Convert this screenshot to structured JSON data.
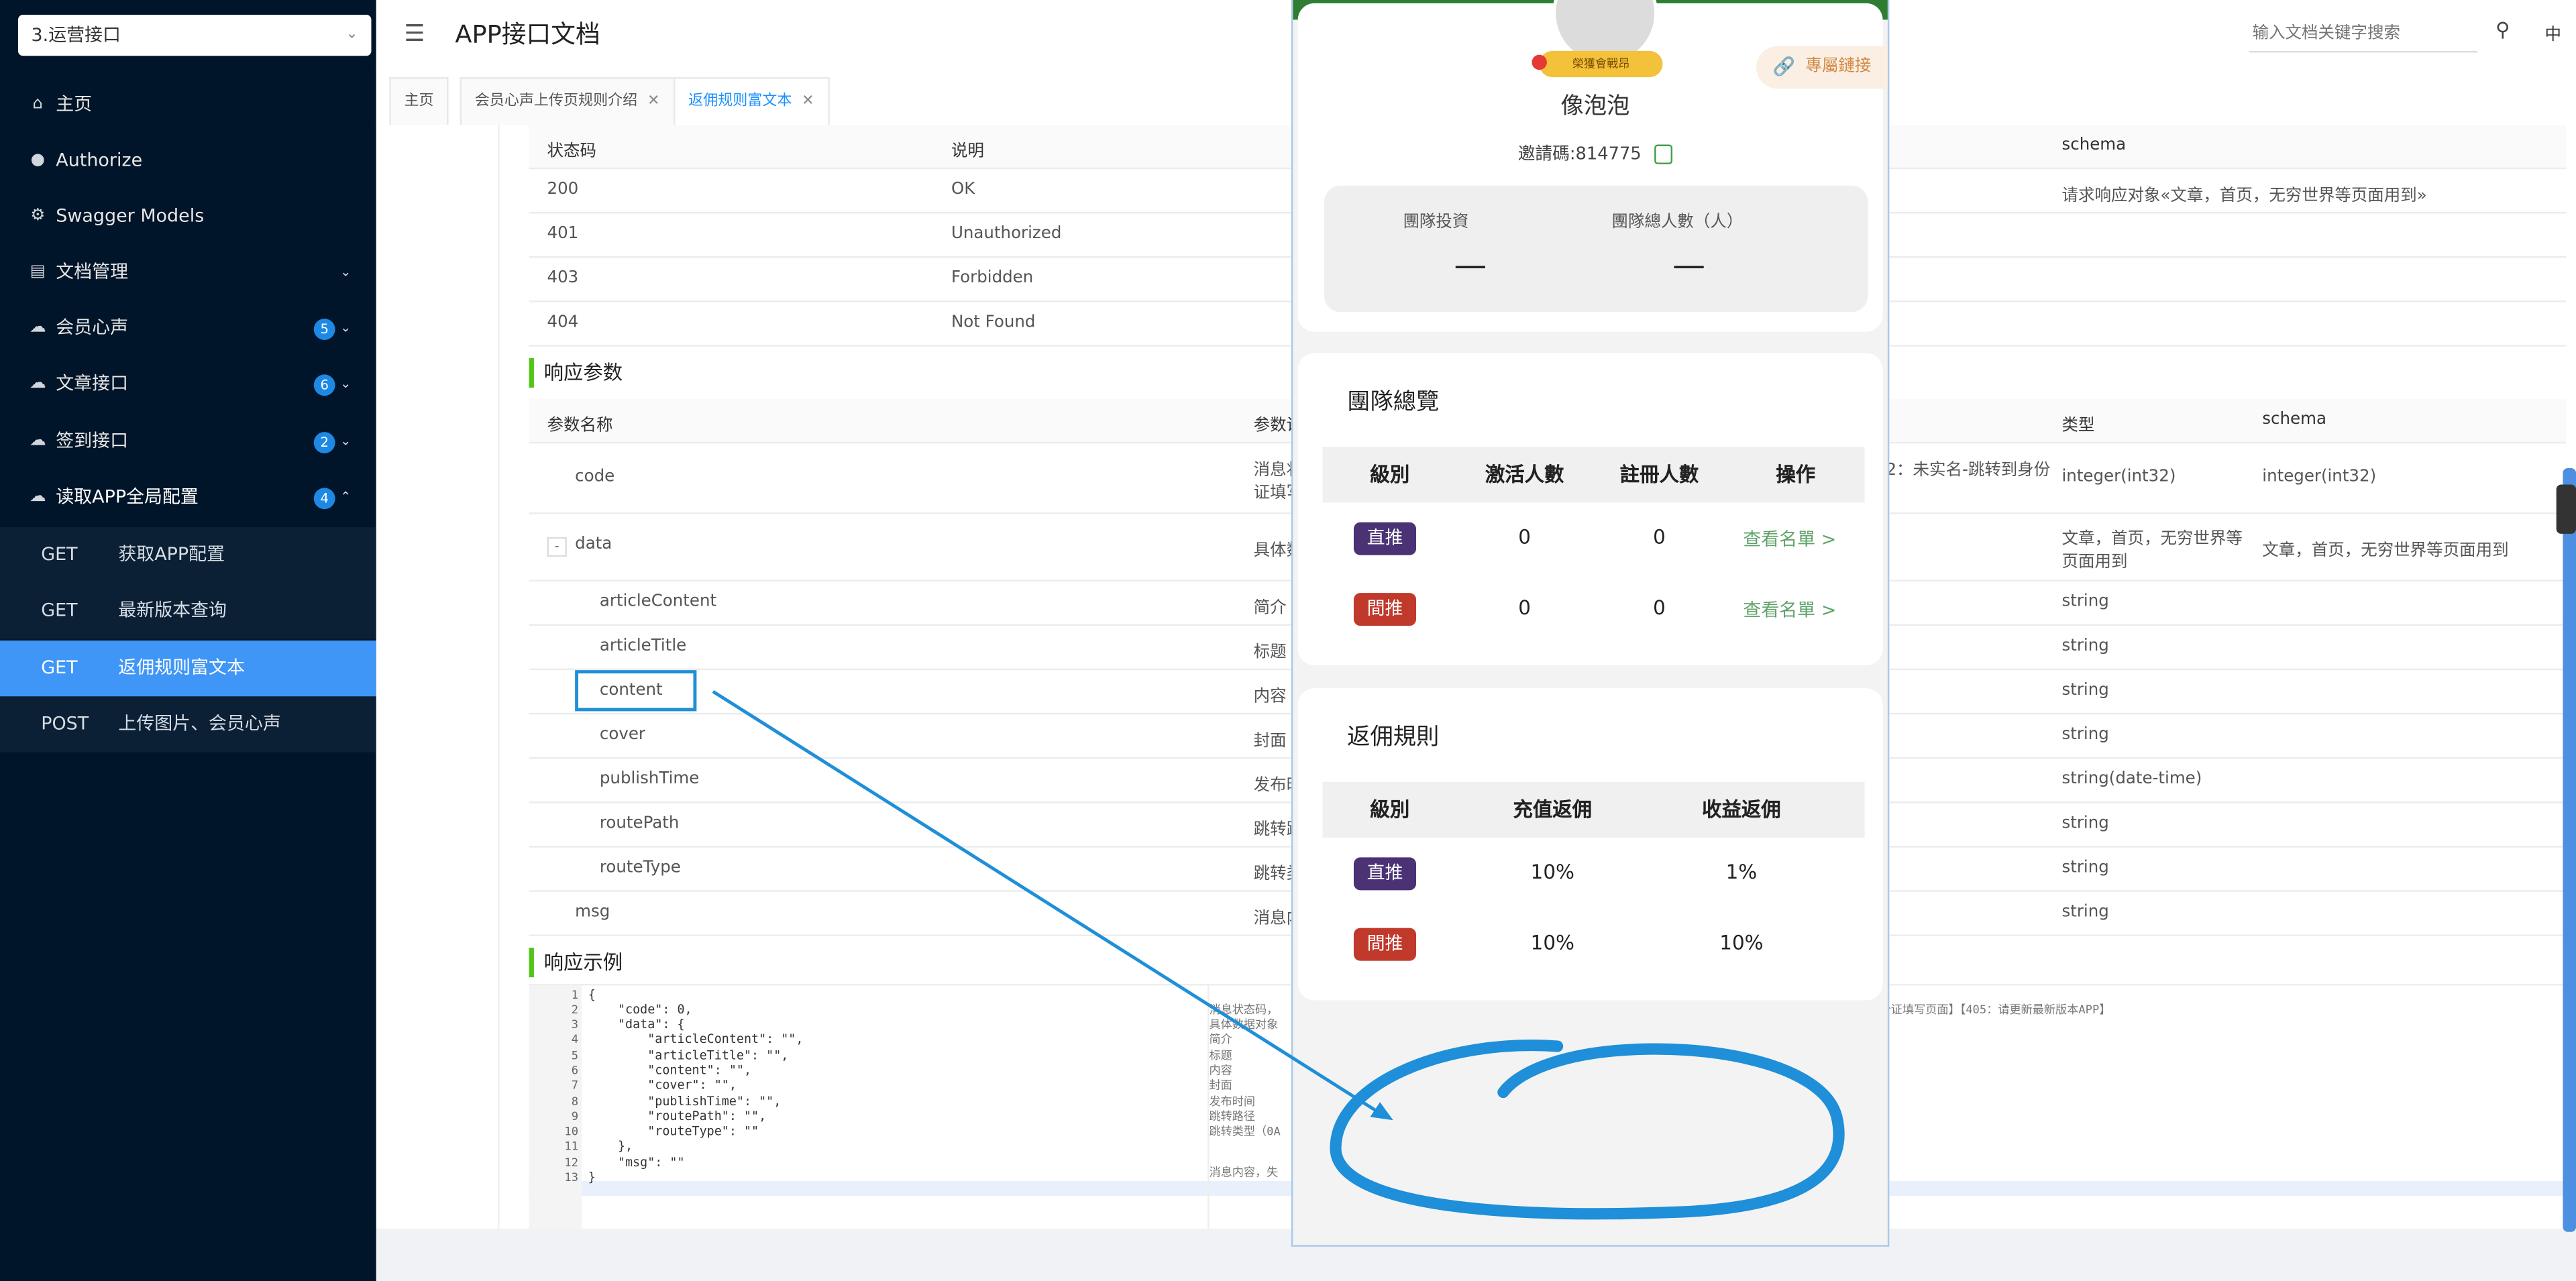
{
  "sidebar": {
    "group_select": "3.运营接口",
    "nav": [
      {
        "label": "主页",
        "icon": "home-icon"
      },
      {
        "label": "Authorize",
        "icon": "key-icon"
      },
      {
        "label": "Swagger Models",
        "icon": "gear-icon"
      },
      {
        "label": "文档管理",
        "icon": "docs-icon"
      },
      {
        "label": "会员心声",
        "icon": "cloud-icon",
        "badge": "5"
      },
      {
        "label": "文章接口",
        "icon": "cloud-icon",
        "badge": "6"
      },
      {
        "label": "签到接口",
        "icon": "cloud-icon",
        "badge": "2"
      },
      {
        "label": "读取APP全局配置",
        "icon": "cloud-icon",
        "badge": "4"
      }
    ],
    "sub": [
      {
        "method": "GET",
        "label": "获取APP配置"
      },
      {
        "method": "GET",
        "label": "最新版本查询"
      },
      {
        "method": "GET",
        "label": "返佣规则富文本"
      },
      {
        "method": "POST",
        "label": "上传图片、会员心声"
      }
    ]
  },
  "header": {
    "title": "APP接口文档",
    "search_placeholder": "输入文档关键字搜索",
    "lang": "中"
  },
  "tabs": [
    {
      "label": "主页"
    },
    {
      "label": "会员心声上传页规则介绍"
    },
    {
      "label": "返佣规则富文本"
    }
  ],
  "status_table": {
    "headers": {
      "code": "状态码",
      "desc": "说明",
      "schema": "schema"
    },
    "rows": [
      {
        "code": "200",
        "desc": "OK",
        "schema": "请求响应对象«文章，首页，无穷世界等页面用到»"
      },
      {
        "code": "401",
        "desc": "Unauthorized",
        "schema": ""
      },
      {
        "code": "403",
        "desc": "Forbidden",
        "schema": ""
      },
      {
        "code": "404",
        "desc": "Not Found",
        "schema": ""
      }
    ]
  },
  "response_params": {
    "title": "响应参数",
    "headers": {
      "name": "参数名称",
      "desc": "参数说",
      "type": "类型",
      "schema": "schema"
    },
    "rows": [
      {
        "name": "code",
        "desc": "消息状",
        "desc2": "证填写",
        "type": "integer(int32)",
        "schema": "integer(int32)",
        "extra": "2：未实名-跳转到身份"
      },
      {
        "name": "data",
        "desc": "具体数",
        "type": "文章，首页，无穷世界等",
        "type2": "页面用到",
        "schema": "文章，首页，无穷世界等页面用到"
      },
      {
        "name": "articleContent",
        "desc": "简介",
        "type": "string"
      },
      {
        "name": "articleTitle",
        "desc": "标题",
        "type": "string"
      },
      {
        "name": "content",
        "desc": "内容",
        "type": "string"
      },
      {
        "name": "cover",
        "desc": "封面",
        "type": "string"
      },
      {
        "name": "publishTime",
        "desc": "发布时",
        "type": "string(date-time)"
      },
      {
        "name": "routePath",
        "desc": "跳转路",
        "type": "string"
      },
      {
        "name": "routeType",
        "desc": "跳转类",
        "type": "string"
      },
      {
        "name": "msg",
        "desc": "消息内",
        "type": "string"
      }
    ],
    "collapse": "-"
  },
  "response_example": {
    "title": "响应示例",
    "line_numbers": [
      "1",
      "2",
      "3",
      "4",
      "5",
      "6",
      "7",
      "8",
      "9",
      "10",
      "11",
      "12",
      "13"
    ],
    "lines": [
      "{",
      "    \"code\": 0,",
      "    \"data\": {",
      "        \"articleContent\": \"\",",
      "        \"articleTitle\": \"\",",
      "        \"content\": \"\",",
      "        \"cover\": \"\",",
      "        \"publishTime\": \"\",",
      "        \"routePath\": \"\",",
      "        \"routeType\": \"\"",
      "    },",
      "    \"msg\": \"\"",
      "}"
    ],
    "descriptions": [
      "",
      "消息状态码，",
      "具体数据对象",
      "简介",
      "标题",
      "内容",
      "封面",
      "发布时间",
      "跳转路径",
      "跳转类型（0A",
      "",
      "消息内容，失",
      ""
    ],
    "desc_right": "份证填写页面】【405：请更新最新版本APP】"
  },
  "phone": {
    "medal": "榮獲會戰昂",
    "username": "像泡泡",
    "invite": "邀請碼:814775",
    "link_label": "專屬鏈接",
    "stats": [
      {
        "label": "團隊投資",
        "value": "—"
      },
      {
        "label": "團隊總人數（人）",
        "value": "—"
      }
    ],
    "overview": {
      "title": "團隊總覽",
      "headers": [
        "級別",
        "激活人數",
        "註冊人數",
        "操作"
      ],
      "rows": [
        {
          "level": "直推",
          "active": "0",
          "registered": "0",
          "action": "查看名單 >"
        },
        {
          "level": "間推",
          "active": "0",
          "registered": "0",
          "action": "查看名單 >"
        }
      ]
    },
    "rebate": {
      "title": "返佣規則",
      "headers": [
        "級別",
        "充值返佣",
        "收益返佣"
      ],
      "rows": [
        {
          "level": "直推",
          "recharge": "10%",
          "income": "1%"
        },
        {
          "level": "間推",
          "recharge": "10%",
          "income": "10%"
        }
      ]
    }
  },
  "colors": {
    "sidebar_bg": "#001529",
    "active_blue": "#4096f7",
    "badge_blue": "#1e88e5",
    "section_green": "#52c41a",
    "annotation_blue": "#1e8fd8",
    "tag_direct": "#4a3275",
    "tag_indirect": "#c0392b"
  }
}
